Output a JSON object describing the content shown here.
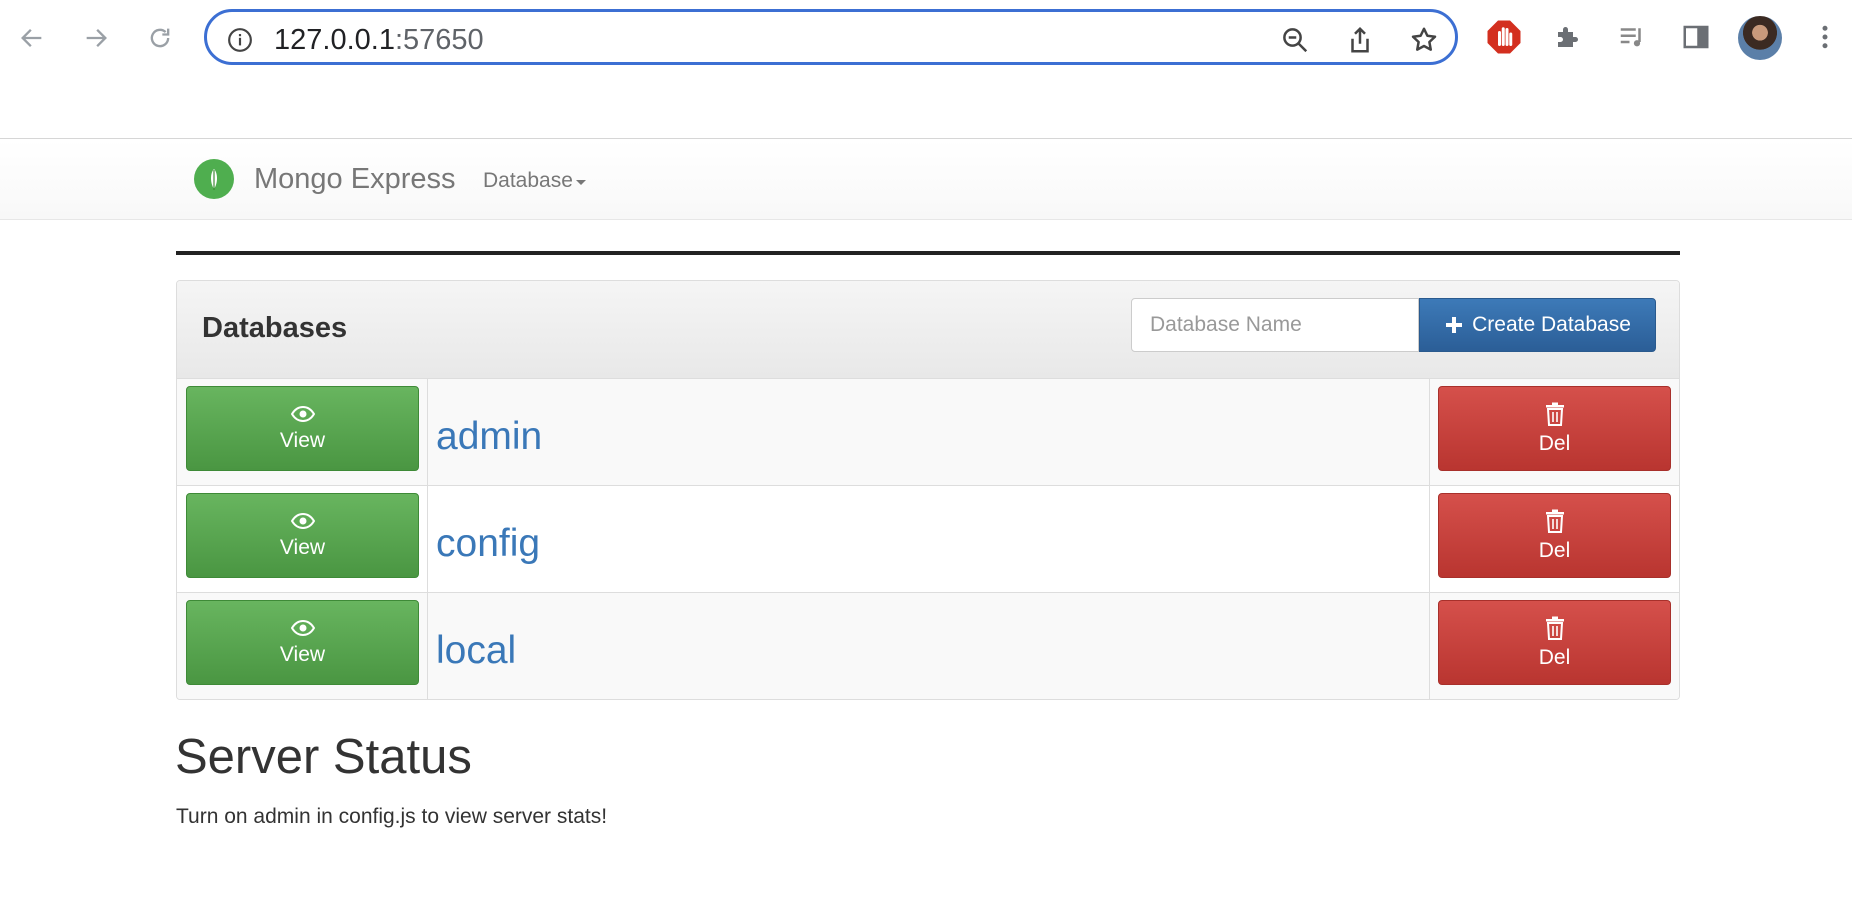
{
  "browser": {
    "url_host": "127.0.0.1",
    "url_port": ":57650"
  },
  "navbar": {
    "brand": "Mongo Express",
    "database_menu": "Database"
  },
  "databases_panel": {
    "title": "Databases",
    "input_placeholder": "Database Name",
    "create_button": "Create Database",
    "rows": [
      {
        "name": "admin",
        "view_label": "View",
        "del_label": "Del"
      },
      {
        "name": "config",
        "view_label": "View",
        "del_label": "Del"
      },
      {
        "name": "local",
        "view_label": "View",
        "del_label": "Del"
      }
    ]
  },
  "server_status": {
    "title": "Server Status",
    "message": "Turn on admin in config.js to view server stats!"
  },
  "colors": {
    "accent_blue": "#3c6fd3",
    "view_green": "#4a9642",
    "delete_red": "#b93530",
    "link_blue": "#3a78b8"
  },
  "icons": {
    "view": "eye-icon",
    "delete": "trash-icon",
    "create": "plus-icon"
  }
}
